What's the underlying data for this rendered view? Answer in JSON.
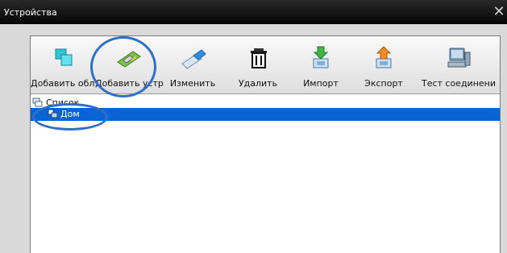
{
  "window": {
    "title": "Устройства",
    "close_glyph": "✕"
  },
  "toolbar": {
    "items": [
      {
        "id": "add-area",
        "label": "Добавить обл",
        "icon": "add-area-icon"
      },
      {
        "id": "add-device",
        "label": "Добавить устр",
        "icon": "network-card-icon"
      },
      {
        "id": "edit",
        "label": "Изменить",
        "icon": "usb-stick-icon"
      },
      {
        "id": "delete",
        "label": "Удалить",
        "icon": "trash-icon"
      },
      {
        "id": "import",
        "label": "Импорт",
        "icon": "import-icon"
      },
      {
        "id": "export",
        "label": "Экспорт",
        "icon": "export-icon"
      },
      {
        "id": "test",
        "label": "Тест соединени",
        "icon": "computer-icon"
      }
    ]
  },
  "tree": {
    "root_label": "Список",
    "items": [
      {
        "label": "Дом",
        "selected": true
      }
    ]
  },
  "colors": {
    "selection": "#0a64d6",
    "annotation": "#2f6fc6",
    "titlebar": "#0a0a0a"
  }
}
